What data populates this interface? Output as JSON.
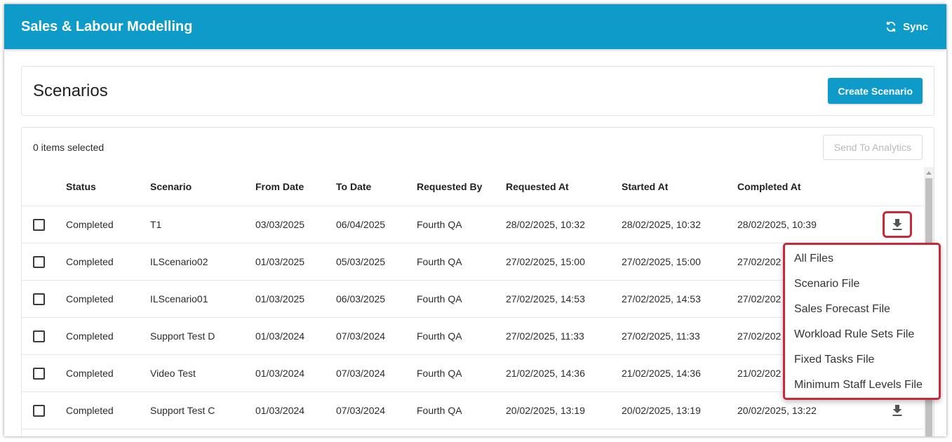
{
  "header": {
    "title": "Sales & Labour Modelling",
    "sync_label": "Sync",
    "color": "#0e9bc9"
  },
  "page": {
    "title": "Scenarios",
    "create_button": "Create Scenario"
  },
  "toolbar": {
    "selected_text": "0 items selected",
    "send_button": "Send To Analytics"
  },
  "table": {
    "columns": [
      "Status",
      "Scenario",
      "From Date",
      "To Date",
      "Requested By",
      "Requested At",
      "Started At",
      "Completed At"
    ],
    "rows": [
      {
        "status": "Completed",
        "scenario": "T1",
        "from": "03/03/2025",
        "to": "06/04/2025",
        "requested_by": "Fourth QA",
        "requested_at": "28/02/2025, 10:32",
        "started_at": "28/02/2025, 10:32",
        "completed_at": "28/02/2025, 10:39"
      },
      {
        "status": "Completed",
        "scenario": "ILScenario02",
        "from": "01/03/2025",
        "to": "05/03/2025",
        "requested_by": "Fourth QA",
        "requested_at": "27/02/2025, 15:00",
        "started_at": "27/02/2025, 15:00",
        "completed_at": "27/02/202"
      },
      {
        "status": "Completed",
        "scenario": "ILScenario01",
        "from": "01/03/2025",
        "to": "06/03/2025",
        "requested_by": "Fourth QA",
        "requested_at": "27/02/2025, 14:53",
        "started_at": "27/02/2025, 14:53",
        "completed_at": "27/02/202"
      },
      {
        "status": "Completed",
        "scenario": "Support Test D",
        "from": "01/03/2024",
        "to": "07/03/2024",
        "requested_by": "Fourth QA",
        "requested_at": "27/02/2025, 11:33",
        "started_at": "27/02/2025, 11:33",
        "completed_at": "27/02/202"
      },
      {
        "status": "Completed",
        "scenario": "Video Test",
        "from": "01/03/2024",
        "to": "07/03/2024",
        "requested_by": "Fourth QA",
        "requested_at": "21/02/2025, 14:36",
        "started_at": "21/02/2025, 14:36",
        "completed_at": "21/02/202"
      },
      {
        "status": "Completed",
        "scenario": "Support Test C",
        "from": "01/03/2024",
        "to": "07/03/2024",
        "requested_by": "Fourth QA",
        "requested_at": "20/02/2025, 13:19",
        "started_at": "20/02/2025, 13:19",
        "completed_at": "20/02/2025, 13:22"
      }
    ]
  },
  "download_menu": {
    "items": [
      "All Files",
      "Scenario File",
      "Sales Forecast File",
      "Workload Rule Sets File",
      "Fixed Tasks File",
      "Minimum Staff Levels File"
    ],
    "highlight_color": "#c8283a"
  },
  "icons": {
    "sync": "sync-icon",
    "download": "download-icon"
  }
}
